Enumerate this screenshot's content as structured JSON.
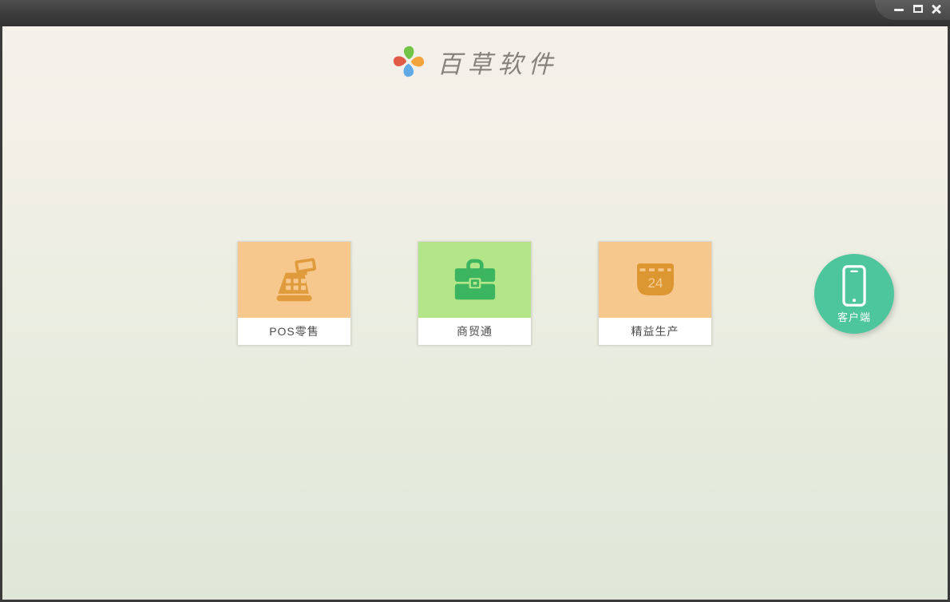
{
  "window": {
    "controls": {
      "minimize": "minimize",
      "maximize": "maximize",
      "close": "close"
    },
    "titlebar_color": "#3f3f3f",
    "frame_color": "#3a3a3a"
  },
  "header": {
    "app_title": "百草软件",
    "logo_colors": {
      "top": "#72c446",
      "right": "#f2a33c",
      "bottom": "#5ea9e6",
      "left": "#e15a48"
    }
  },
  "products": [
    {
      "label": "POS零售",
      "icon": "cash-register-icon",
      "card_color": "#f7c88d",
      "icon_color": "#e09b3d"
    },
    {
      "label": "商贸通",
      "icon": "briefcase-icon",
      "card_color": "#b3e589",
      "icon_color": "#3bb55f"
    },
    {
      "label": "精益生产",
      "icon": "calendar-icon",
      "card_color": "#f7c88d",
      "icon_color": "#dc9733",
      "calendar_day": "24"
    }
  ],
  "client": {
    "label": "客户端",
    "icon": "smartphone-icon",
    "circle_color": "#4ec69d"
  },
  "background": {
    "top": "#f4f1ea",
    "bottom": "#dfe7d9"
  }
}
